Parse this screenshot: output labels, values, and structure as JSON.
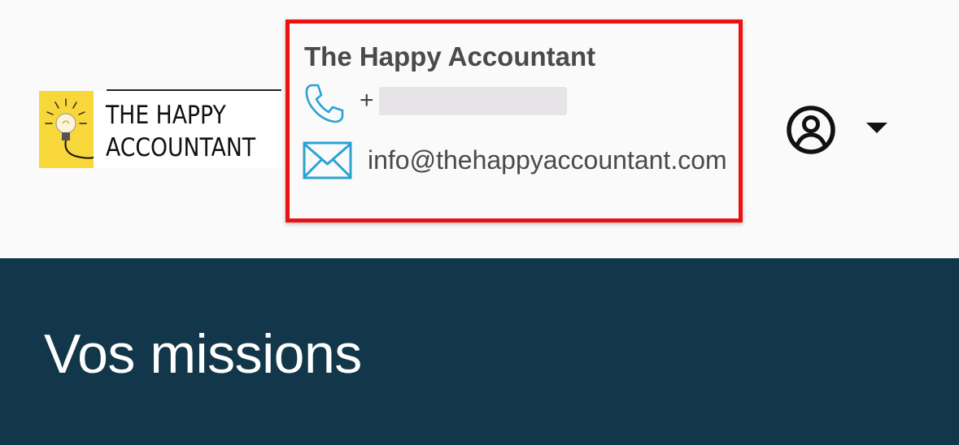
{
  "logo": {
    "line1": "THE HAPPY",
    "line2": "ACCOUNTANT",
    "icon": "lightbulb-icon",
    "bg_color": "#f7d73a"
  },
  "contact": {
    "title": "The Happy Accountant",
    "phone_icon": "phone-icon",
    "phone_prefix": "+",
    "email_icon": "mail-icon",
    "email": "info@thehappyaccountant.com",
    "icon_color": "#2aa3d3",
    "highlight_color": "#ee1111"
  },
  "account": {
    "icon": "user-circle-icon",
    "menu_icon": "caret-down-icon"
  },
  "banner": {
    "title": "Vos missions",
    "bg_color": "#12364a"
  }
}
